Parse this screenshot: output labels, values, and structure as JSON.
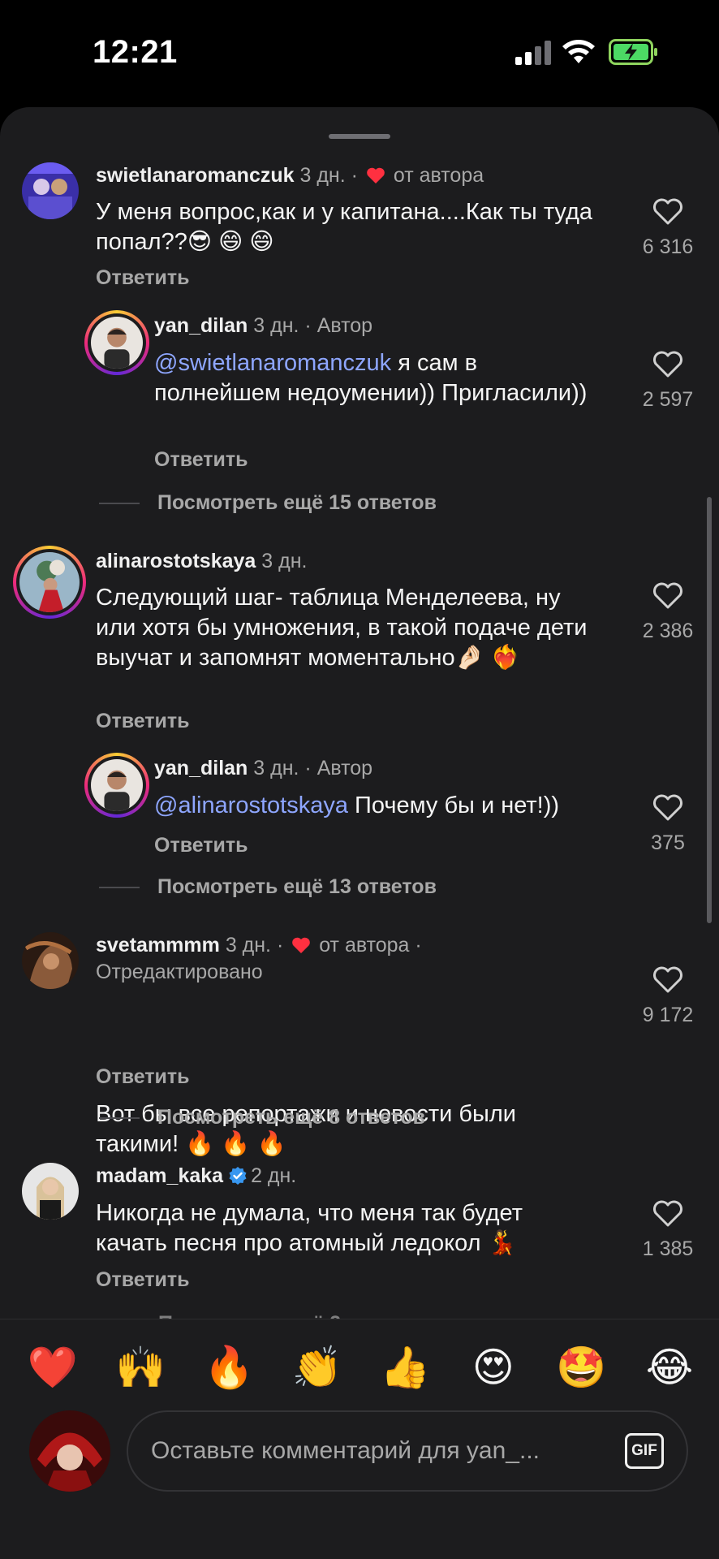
{
  "status_bar": {
    "time": "12:21"
  },
  "comments": [
    {
      "username": "swietlanaromanczuk",
      "time": "3 дн.",
      "author_liked": "от автора",
      "text": "У меня вопрос,как и у капитана....Как ты туда попал??😎 😄 😄",
      "reply_label": "Ответить",
      "likes": "6 316"
    },
    {
      "username": "yan_dilan",
      "time": "3 дн.",
      "badge": "Автор",
      "mention": "@swietlanaromanczuk",
      "text": " я сам в полнейшем недоумении)) Пригласили))",
      "reply_label": "Ответить",
      "likes": "2 597"
    },
    {
      "more_replies": "Посмотреть ещё 15 ответов"
    },
    {
      "username": "alinarostotskaya",
      "time": "3 дн.",
      "text": "Следующий шаг- таблица Менделеева, ну или хотя бы умножения, в такой подаче дети выучат и запомнят моментально🤌🏻 ❤️‍🔥",
      "reply_label": "Ответить",
      "likes": "2 386"
    },
    {
      "username": "yan_dilan",
      "time": "3 дн.",
      "badge": "Автор",
      "mention": "@alinarostotskaya",
      "text": " Почему бы и нет!))",
      "reply_label": "Ответить",
      "likes": "375"
    },
    {
      "more_replies": "Посмотреть ещё 13 ответов"
    },
    {
      "username": "svetammmm",
      "time": "3 дн.",
      "author_liked": "от автора",
      "edited": "Отредактировано",
      "text": "Вот бы все репортажи и новости были такими! 🔥 🔥 🔥",
      "reply_label": "Ответить",
      "likes": "9 172"
    },
    {
      "more_replies": "Посмотреть ещё 8 ответов"
    },
    {
      "username": "madam_kaka",
      "time": "2 дн.",
      "text": "Никогда не думала, что меня так будет качать песня про атомный ледокол 💃",
      "reply_label": "Ответить",
      "likes": "1 385"
    },
    {
      "more_replies_truncated": "Посмотреть ещё 2..."
    }
  ],
  "emoji_bar": [
    "❤️",
    "🙌",
    "🔥",
    "👏",
    "👍",
    "😍",
    "🤩",
    "😂"
  ],
  "composer": {
    "placeholder": "Оставьте комментарий для yan_...",
    "gif_label": "GIF"
  },
  "colors": {
    "sheet_bg": "#1c1c1e",
    "mention": "#8ea6ff",
    "secondary_text": "#a8a8a8",
    "like_heart_red": "#ff3040",
    "verified_blue": "#3897f0"
  }
}
